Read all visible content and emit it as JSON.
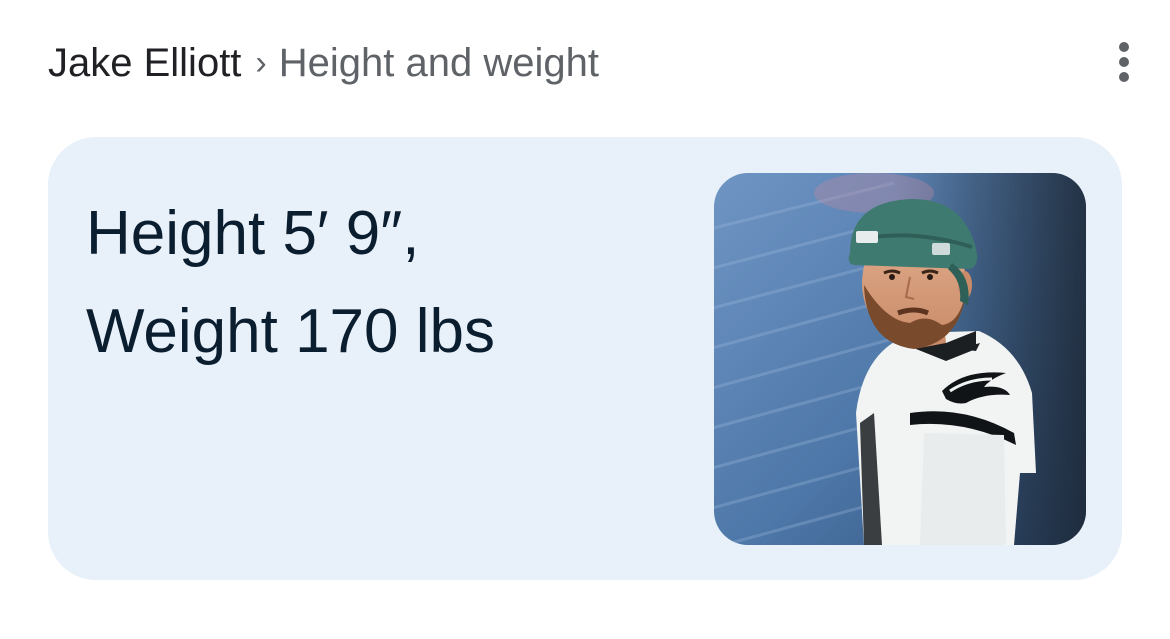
{
  "breadcrumb": {
    "entity": "Jake Elliott",
    "separator": "›",
    "topic": "Height and weight"
  },
  "menu": {
    "icon": "more-vert-icon"
  },
  "answer": {
    "line1": "Height 5′ 9″,",
    "line2": "Weight 170 lbs"
  },
  "image": {
    "subject": "athlete-portrait",
    "colors": {
      "stadium": "#4d77a8",
      "cap": "#3f7a70",
      "jersey": "#f2f4f4",
      "beard": "#7a4a2c"
    }
  }
}
